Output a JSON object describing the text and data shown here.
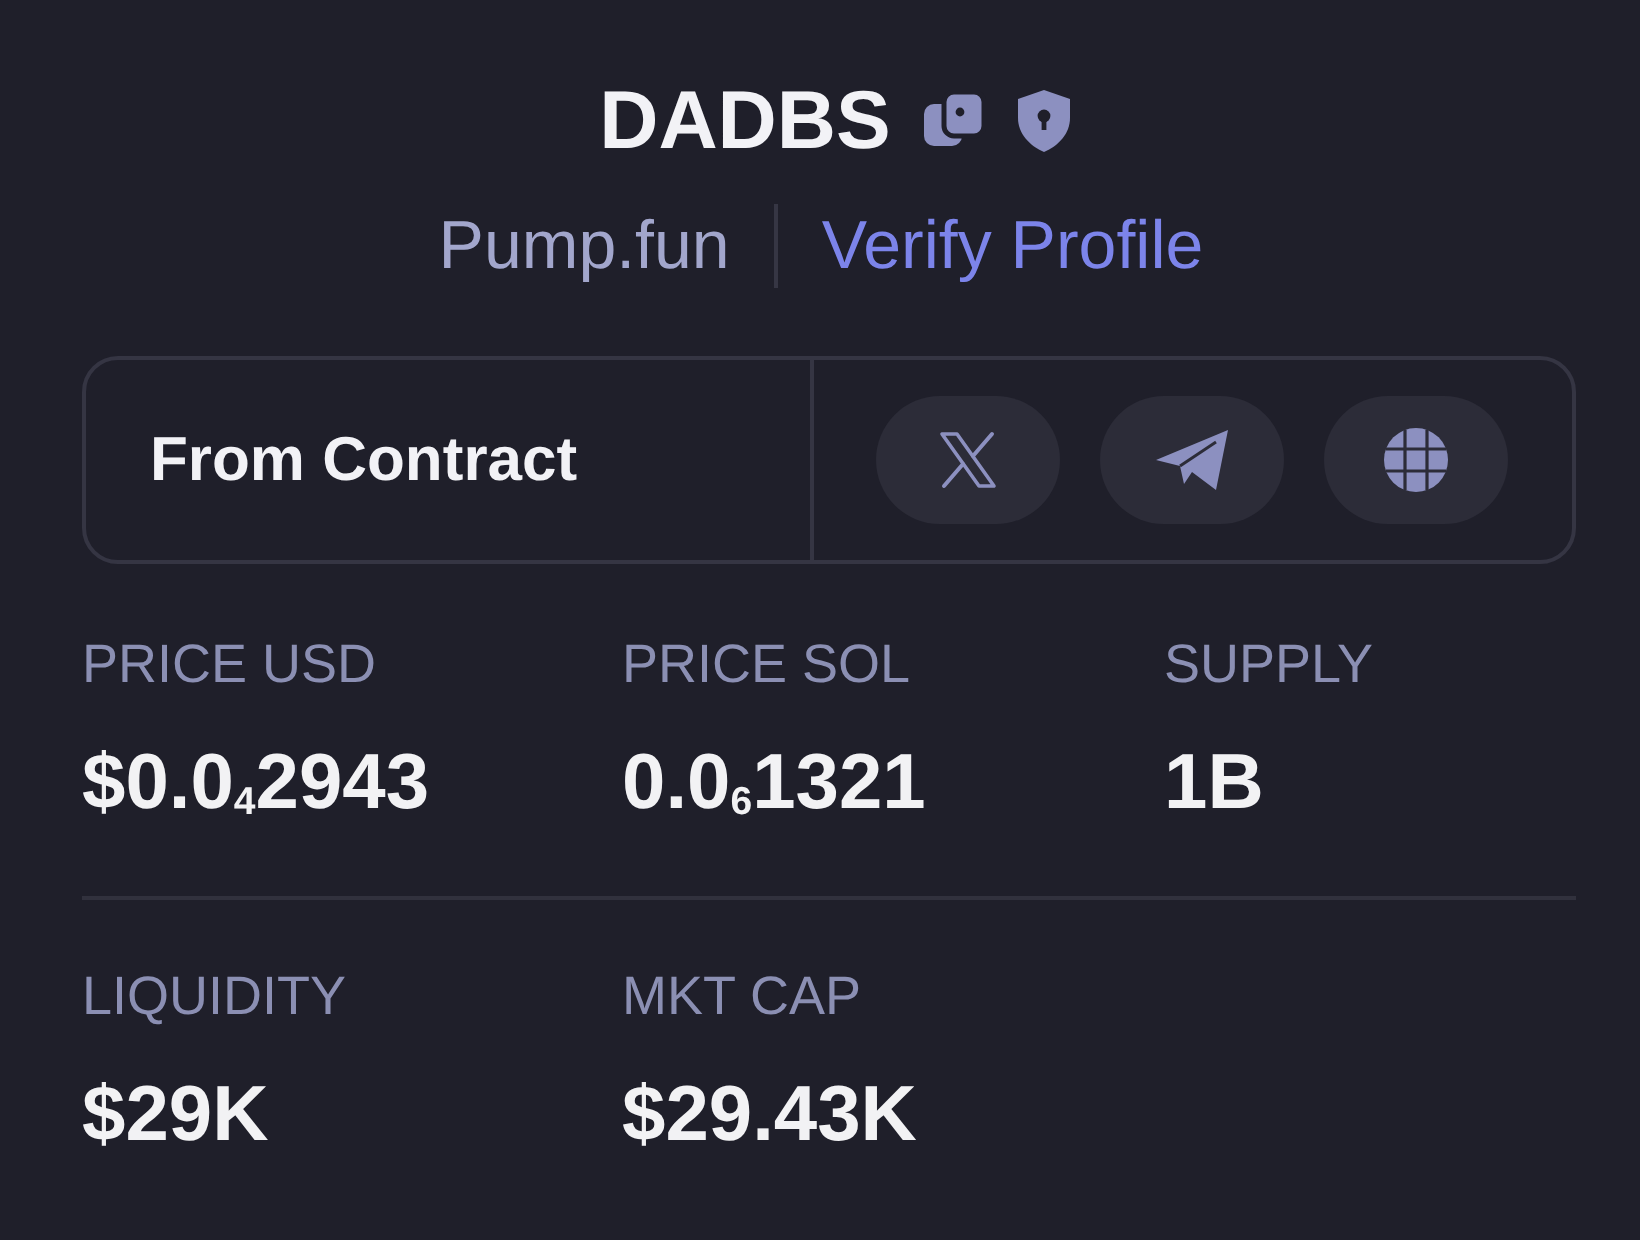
{
  "token": {
    "symbol": "DADBS",
    "source": "Pump.fun",
    "verify_link": "Verify Profile"
  },
  "socials": {
    "label": "From Contract",
    "buttons": [
      {
        "kind": "x"
      },
      {
        "kind": "telegram"
      },
      {
        "kind": "website"
      }
    ]
  },
  "stat_rows": [
    {
      "items": [
        {
          "label": "PRICE USD",
          "value": "$0.0$_{4}$2943"
        },
        {
          "label": "PRICE SOL",
          "value": "0.0$_{6}$1321"
        },
        {
          "label": "SUPPLY",
          "value": "1B"
        }
      ]
    },
    {
      "items": [
        {
          "label": "LIQUIDITY",
          "value": "$29K"
        },
        {
          "label": "MKT CAP",
          "value": "$29.43K"
        }
      ]
    }
  ]
}
